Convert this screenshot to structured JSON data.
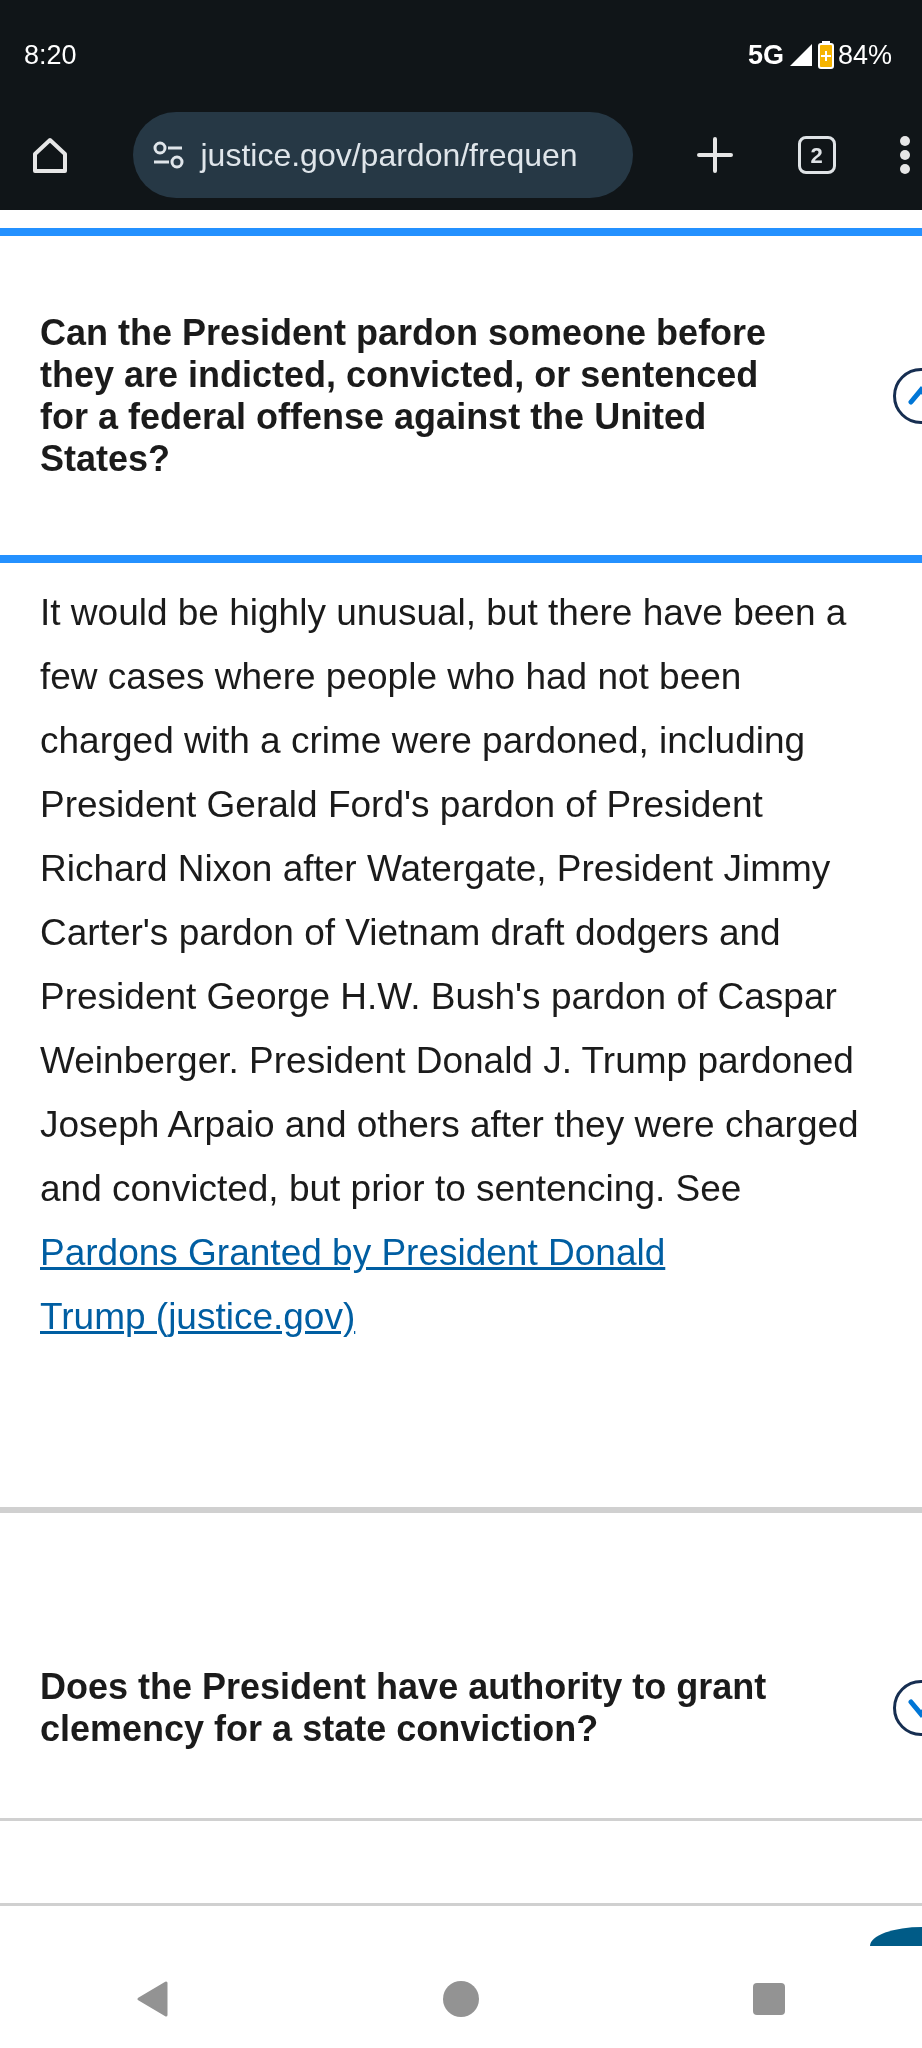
{
  "status_bar": {
    "time": "8:20",
    "network": "5G",
    "battery": "84%"
  },
  "browser": {
    "url": "justice.gov/pardon/frequen",
    "tab_count": "2"
  },
  "faq": [
    {
      "question": "Can the President pardon someone before they are indicted, convicted, or sentenced for a federal offense against the United States?",
      "expanded": true,
      "answer": "It would be highly unusual, but there have been a few cases where people who had not been charged with a crime were pardoned, including President Gerald Ford's pardon of President Richard Nixon after Watergate, President Jimmy Carter's pardon of Vietnam draft dodgers and President George H.W. Bush's pardon of Caspar Weinberger. President Donald J. Trump pardoned Joseph Arpaio and others after they were charged and convicted, but prior to sentencing. See ",
      "link": "Pardons Granted by President Donald Trump (justice.gov)"
    },
    {
      "question": "Does the President have authority to grant clemency for a state conviction?",
      "expanded": false
    }
  ]
}
